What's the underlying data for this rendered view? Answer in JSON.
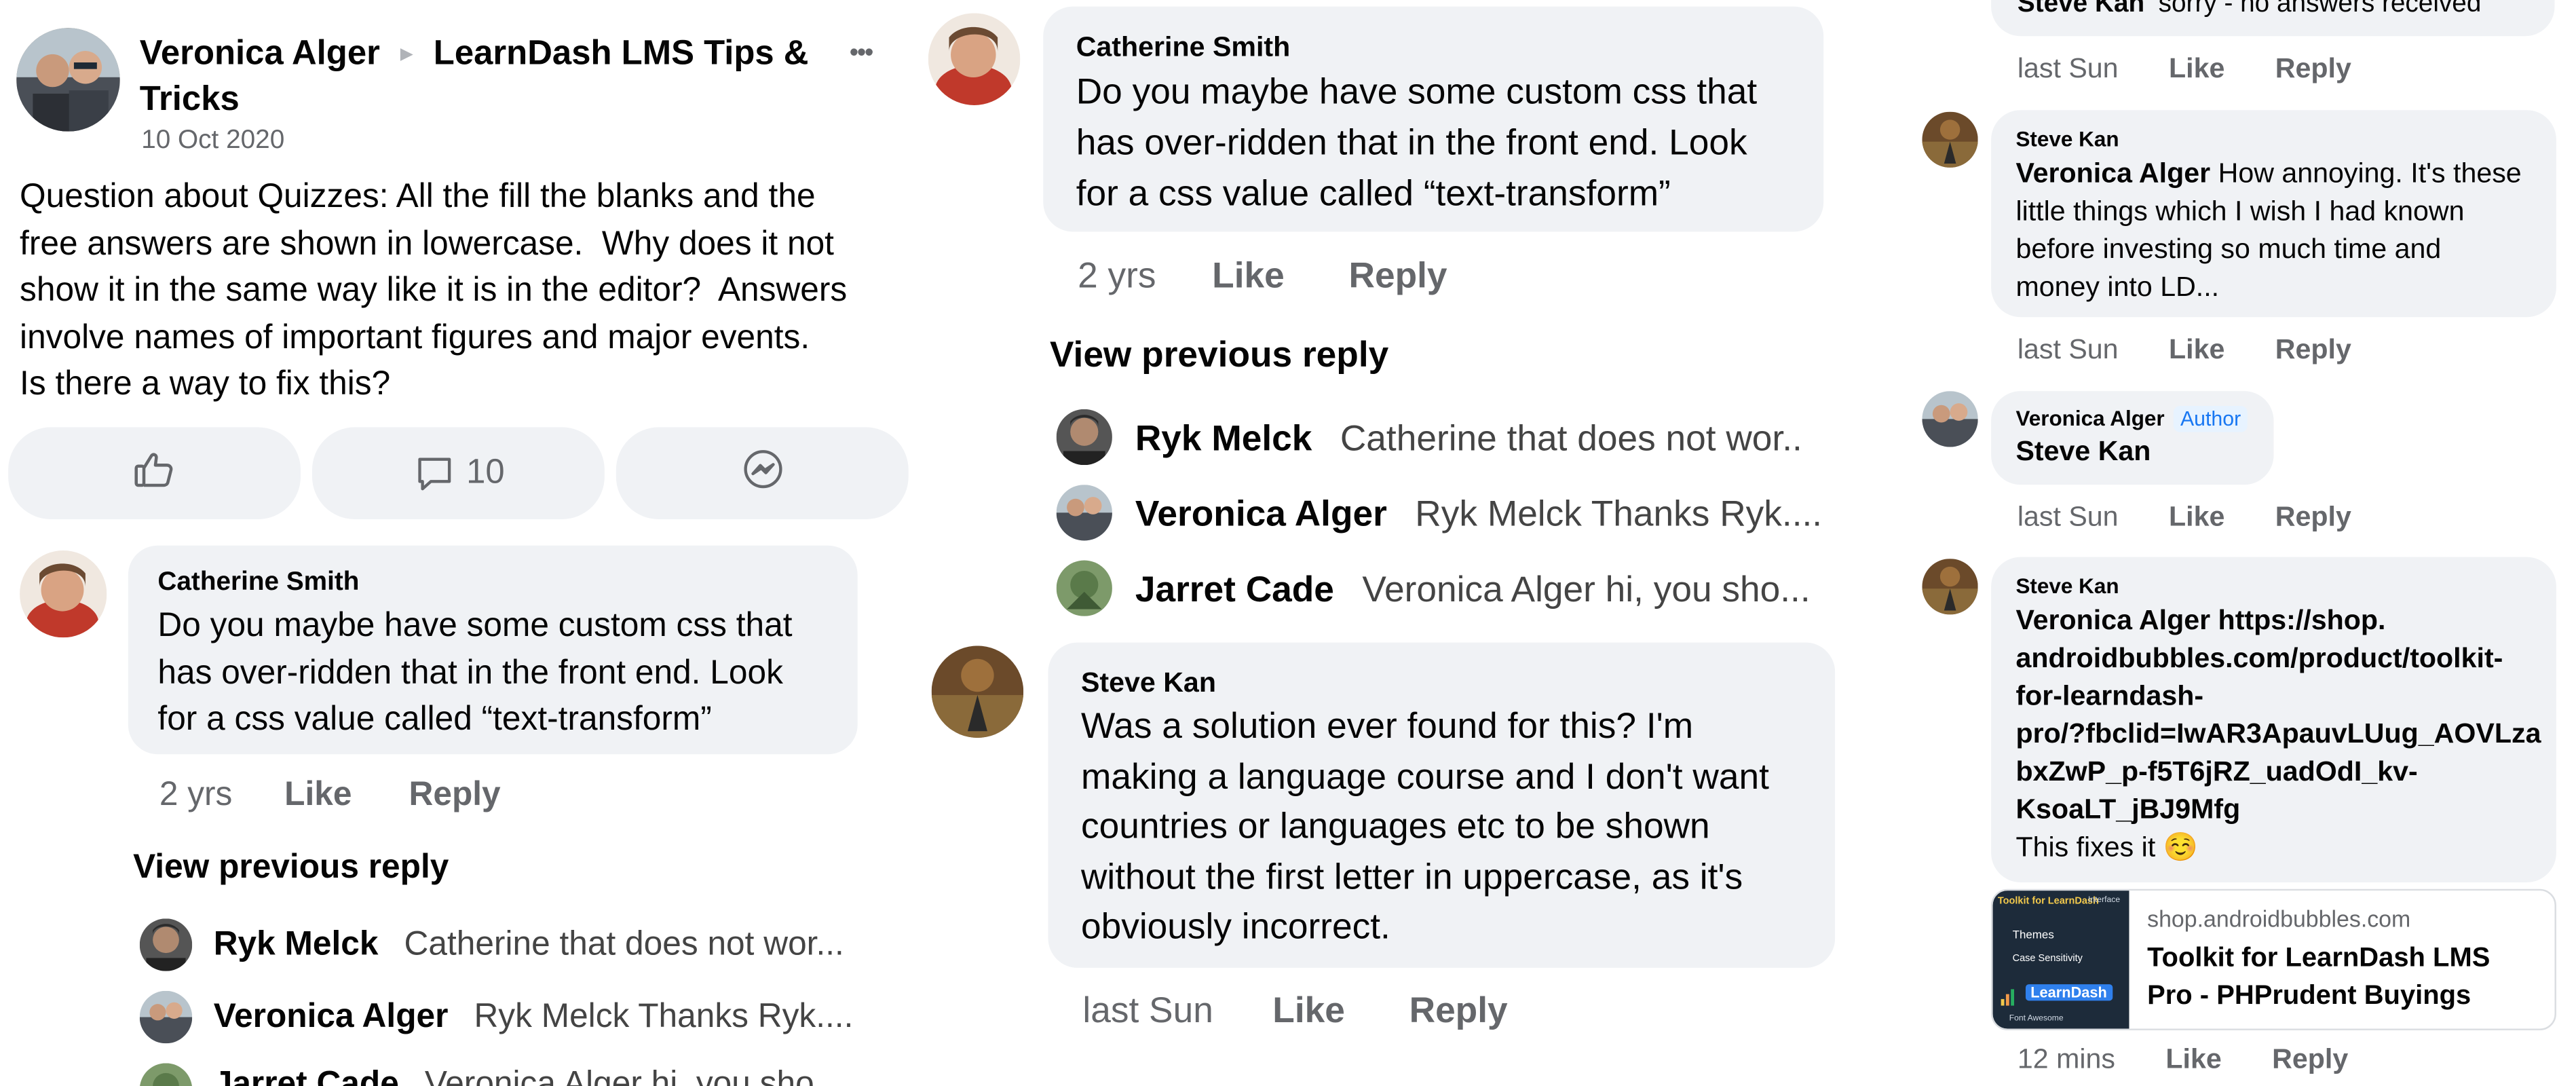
{
  "post": {
    "author": "Veronica Alger",
    "separator": "►",
    "group": "LearnDash LMS Tips & Tricks",
    "group_line1": "LearnDash LMS Tips &",
    "group_line2": "Tricks",
    "date": "10 Oct 2020",
    "more": "•••",
    "body_lines": [
      "Question about Quizzes: All the fill the blanks and the",
      "free answers are shown in lowercase.  Why does it not",
      "show it in the same way like it is in the editor?  Answers",
      "involve names of important figures and major events.",
      "Is there a way to fix this?"
    ],
    "comment_count": "10"
  },
  "actions": {
    "like": "Like",
    "reply": "Reply"
  },
  "catherine": {
    "name": "Catherine Smith",
    "lines": [
      "Do you maybe have some custom css that",
      "has over-ridden that in the front end. Look",
      "for a css value called “text-transform”"
    ],
    "time": "2 yrs"
  },
  "view_previous": "View previous reply",
  "replies": [
    {
      "name": "Ryk Melck",
      "text": "Catherine that does not wor..",
      "text_p1": "Catherine that does not wor..."
    },
    {
      "name": "Veronica Alger",
      "text": "Ryk Melck Thanks Ryk...."
    },
    {
      "name": "Jarret Cade",
      "text": "Veronica Alger hi, you sho...",
      "text_p1": "Veronica Alger hi, you sho..."
    }
  ],
  "steve_question": {
    "name": "Steve Kan",
    "lines": [
      "Was a solution ever found for this? I'm",
      "making a language course and I don't want",
      "countries or languages etc to be shown",
      "without the first letter in uppercase, as it's",
      "obviously incorrect."
    ],
    "time": "last Sun"
  },
  "panel3": {
    "top_partial": {
      "name": "Steve Kan",
      "text": "sorry - no answers received",
      "time": "last Sun"
    },
    "steve_annoyed": {
      "name": "Steve Kan",
      "mention": "Veronica Alger",
      "line1": "How annoying. It's these",
      "lines": [
        "little things which I wish I had known",
        "before investing so much time and",
        "money into LD..."
      ],
      "time": "last Sun"
    },
    "veronica_tag": {
      "name": "Veronica Alger",
      "badge": "Author",
      "mention": "Steve Kan",
      "time": "last Sun"
    },
    "steve_link": {
      "name": "Steve Kan",
      "link_lines": [
        "Veronica Alger https://shop.",
        "androidbubbles.com/product/toolkit-",
        "for-learndash-",
        "pro/?fbclid=IwAR3ApauvLUug_AOVLza",
        "bxZwP_p-f5T6jRZ_uadOdI_kv-",
        "KsoaLT_jBJ9Mfg"
      ],
      "tail": "This fixes it",
      "emoji": "☺️",
      "time": "12 mins"
    },
    "link_card": {
      "domain": "shop.androidbubbles.com",
      "title_lines": [
        "Toolkit for LearnDash LMS",
        "Pro - PHPrudent Buyings"
      ],
      "thumb": {
        "brand": "Toolkit for LearnDash",
        "items": [
          "Themes",
          "Case Sensitivity"
        ],
        "logo": "LearnDash",
        "badge": "Interface",
        "foot": "Font Awesome"
      }
    }
  },
  "colors": {
    "bubble": "#f0f2f5",
    "meta": "#65676b",
    "text": "#050505",
    "author_badge_bg": "#e7f3ff",
    "author_badge_fg": "#1877f2"
  },
  "icons": [
    "more-options-icon",
    "like-thumb-icon",
    "comment-icon",
    "messenger-icon",
    "separator-arrow-icon",
    "smiling-emoji-icon"
  ]
}
